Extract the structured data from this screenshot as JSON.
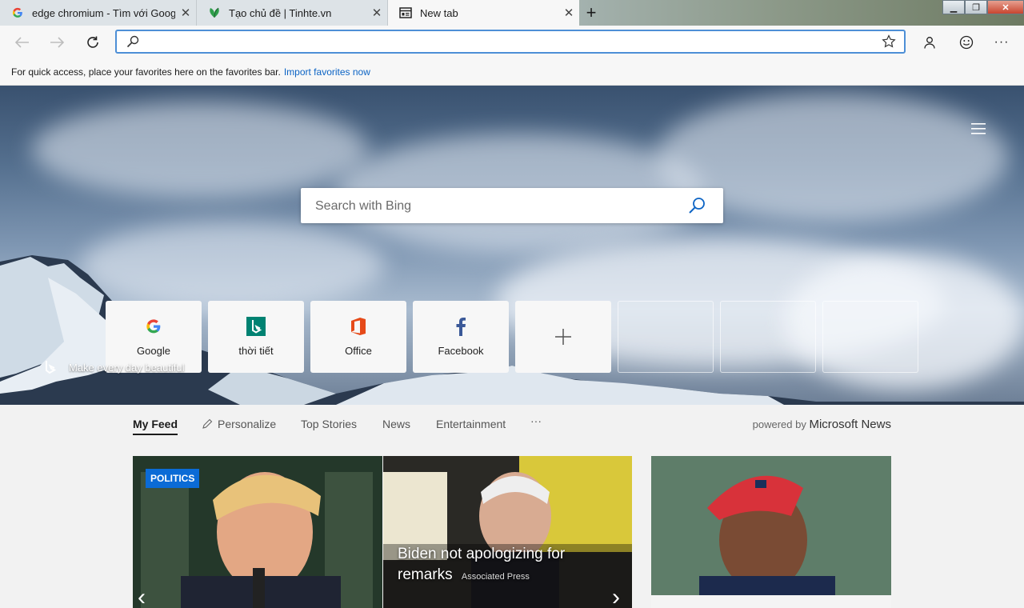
{
  "tabs": [
    {
      "title": "edge chromium - Tìm với Google",
      "icon": "google-g-icon",
      "active": false
    },
    {
      "title": "Tạo chủ đề | Tinhte.vn",
      "icon": "tinhte-icon",
      "active": false
    },
    {
      "title": "New tab",
      "icon": "newtab-page-icon",
      "active": true
    }
  ],
  "address_bar": {
    "value": "",
    "placeholder": ""
  },
  "favorites_bar": {
    "message": "For quick access, place your favorites here on the favorites bar.",
    "link": "Import favorites now"
  },
  "search": {
    "placeholder": "Search with Bing"
  },
  "quick_links": [
    {
      "label": "Google",
      "icon": "google-g-icon"
    },
    {
      "label": "thời tiết",
      "icon": "bing-icon"
    },
    {
      "label": "Office",
      "icon": "office-icon"
    },
    {
      "label": "Facebook",
      "icon": "facebook-icon"
    }
  ],
  "bing_caption": "Make every day beautiful",
  "feed_nav": {
    "items": [
      "My Feed",
      "Personalize",
      "Top Stories",
      "News",
      "Entertainment"
    ],
    "active": "My Feed",
    "more": "···",
    "powered_prefix": "powered by",
    "powered_brand": "Microsoft News"
  },
  "cards": [
    {
      "badge": "POLITICS"
    },
    {
      "headline": "Biden not apologizing for remarks",
      "source": "Associated Press"
    },
    {}
  ],
  "colors": {
    "accent": "#0b63c4",
    "badge": "#0b6bd6",
    "address_border": "#4d8fd6"
  }
}
